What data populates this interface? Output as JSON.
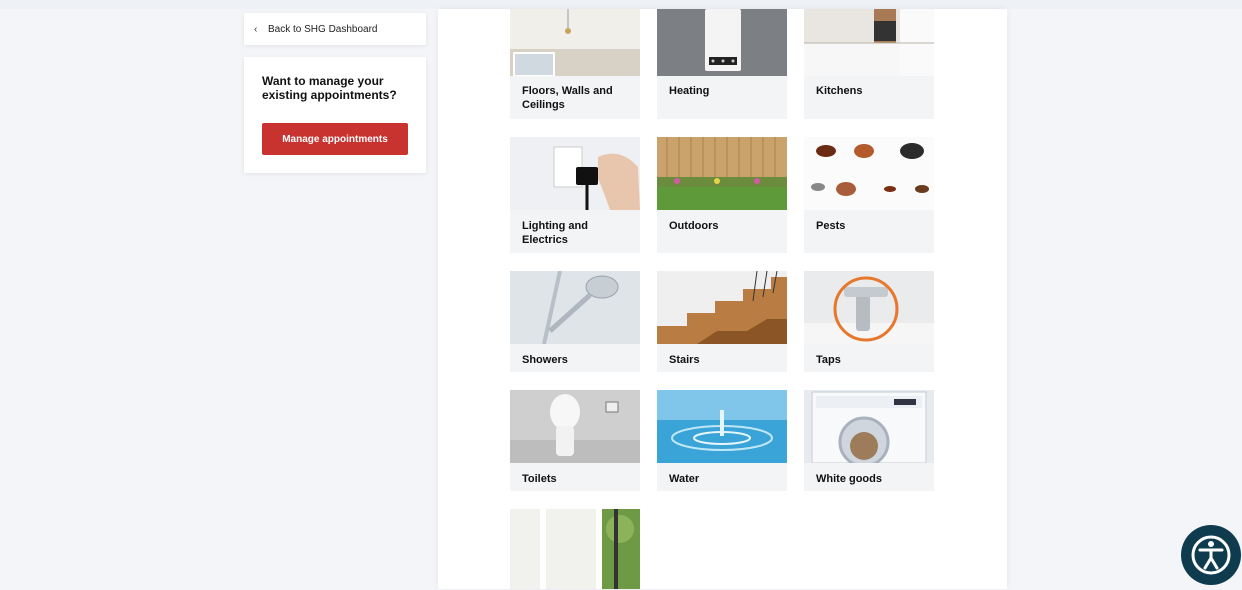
{
  "sidebar": {
    "back_link": "Back to SHG Dashboard",
    "manage_question": "Want to manage your existing appointments?",
    "manage_button": "Manage appointments"
  },
  "categories": [
    {
      "label": "Floors, Walls and Ceilings"
    },
    {
      "label": "Heating"
    },
    {
      "label": "Kitchens"
    },
    {
      "label": "Lighting and Electrics"
    },
    {
      "label": "Outdoors"
    },
    {
      "label": "Pests"
    },
    {
      "label": "Showers"
    },
    {
      "label": "Stairs"
    },
    {
      "label": "Taps"
    },
    {
      "label": "Toilets"
    },
    {
      "label": "Water"
    },
    {
      "label": "White goods"
    },
    {
      "label": ""
    }
  ],
  "colors": {
    "accent": "#c8322f",
    "highlight_ring": "#e8772e",
    "accessibility_button": "#0f3b4f"
  },
  "icons": {
    "back": "chevron-left-icon",
    "accessibility": "accessibility-icon"
  }
}
